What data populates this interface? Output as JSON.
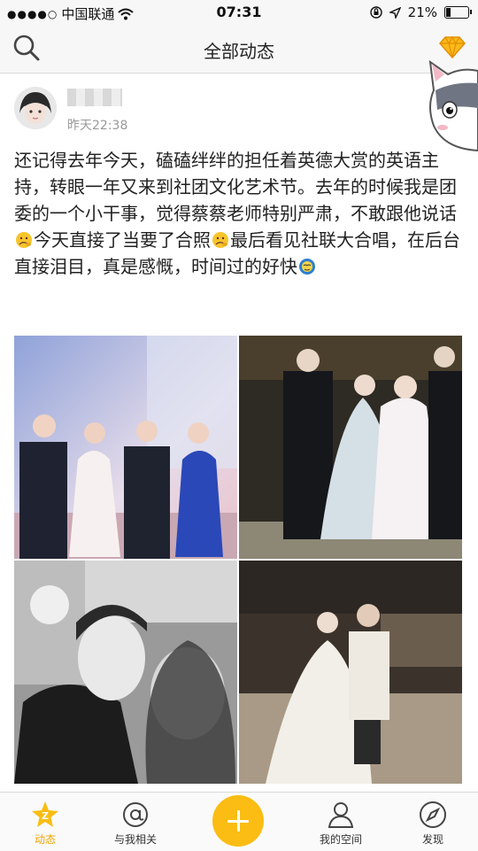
{
  "status_bar": {
    "carrier": "中国联通",
    "time": "07:31",
    "battery_percent": "21%",
    "battery_level": 0.21,
    "icons": [
      "signal-dots-icon",
      "wifi-icon",
      "orientation-lock-icon",
      "location-arrow-icon",
      "battery-icon"
    ]
  },
  "nav": {
    "title": "全部动态",
    "left_icon": "search-icon",
    "right_icon": "diamond-icon"
  },
  "post": {
    "time": "昨天22:38",
    "text_parts": [
      "还记得去年今天，磕磕绊绊的担任着英德大赏的英语主持，转眼一年又来到社团文化艺术节。去年的时候我是团委的一个小干事，觉得蔡蔡老师特别严肃，不敢跟他说话",
      "今天直接了当要了合照",
      "最后看见社联大合唱，在后台直接泪目，真是感慨，时间过的好快"
    ],
    "emojis": [
      "thinking-face-emoji",
      "thinking-face-emoji",
      "cry-face-emoji"
    ],
    "photos": [
      {
        "name": "photo-stage-group",
        "colors": [
          "#7a8fc9",
          "#e8c9d6"
        ]
      },
      {
        "name": "photo-stage-four",
        "colors": [
          "#2a2620",
          "#7e7a6e"
        ]
      },
      {
        "name": "photo-selfie-bw",
        "colors": [
          "#606060",
          "#d8d8d8"
        ]
      },
      {
        "name": "photo-backstage",
        "colors": [
          "#3a2f28",
          "#b8a892"
        ]
      }
    ]
  },
  "tabs": [
    {
      "label": "动态",
      "icon": "feed-icon",
      "active": true
    },
    {
      "label": "与我相关",
      "icon": "at-icon",
      "active": false
    },
    {
      "label": "我的空间",
      "icon": "person-icon",
      "active": false
    },
    {
      "label": "发现",
      "icon": "compass-icon",
      "active": false
    }
  ],
  "colors": {
    "accent": "#fbbd13",
    "active_tab": "#f3a400",
    "text": "#222222",
    "muted": "#999999"
  }
}
